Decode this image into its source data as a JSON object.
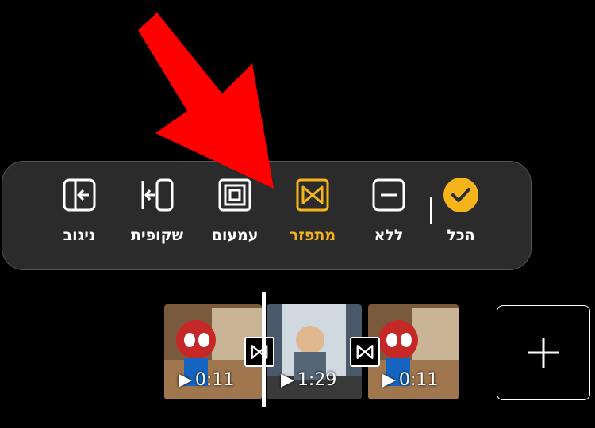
{
  "transition_menu": {
    "options": [
      {
        "id": "all",
        "label": "הכל",
        "icon": "check-circle-icon",
        "selected": false
      },
      {
        "id": "none",
        "label": "ללא",
        "icon": "minus-square-icon",
        "selected": false
      },
      {
        "id": "dissolve",
        "label": "מתפזר",
        "icon": "bowtie-icon",
        "selected": true
      },
      {
        "id": "fade",
        "label": "עמעום",
        "icon": "concentric-squares-icon",
        "selected": false
      },
      {
        "id": "transparency",
        "label": "שקופית",
        "icon": "slide-right-icon",
        "selected": false
      },
      {
        "id": "wipe",
        "label": "ניגוב",
        "icon": "wipe-left-icon",
        "selected": false
      }
    ],
    "accent_color": "#f4b41a"
  },
  "timeline": {
    "clips": [
      {
        "duration": "0:11"
      },
      {
        "duration": "1:29"
      },
      {
        "duration": "0:11"
      }
    ],
    "add_button": "+"
  },
  "annotation": {
    "arrow_color": "#ff0000"
  }
}
